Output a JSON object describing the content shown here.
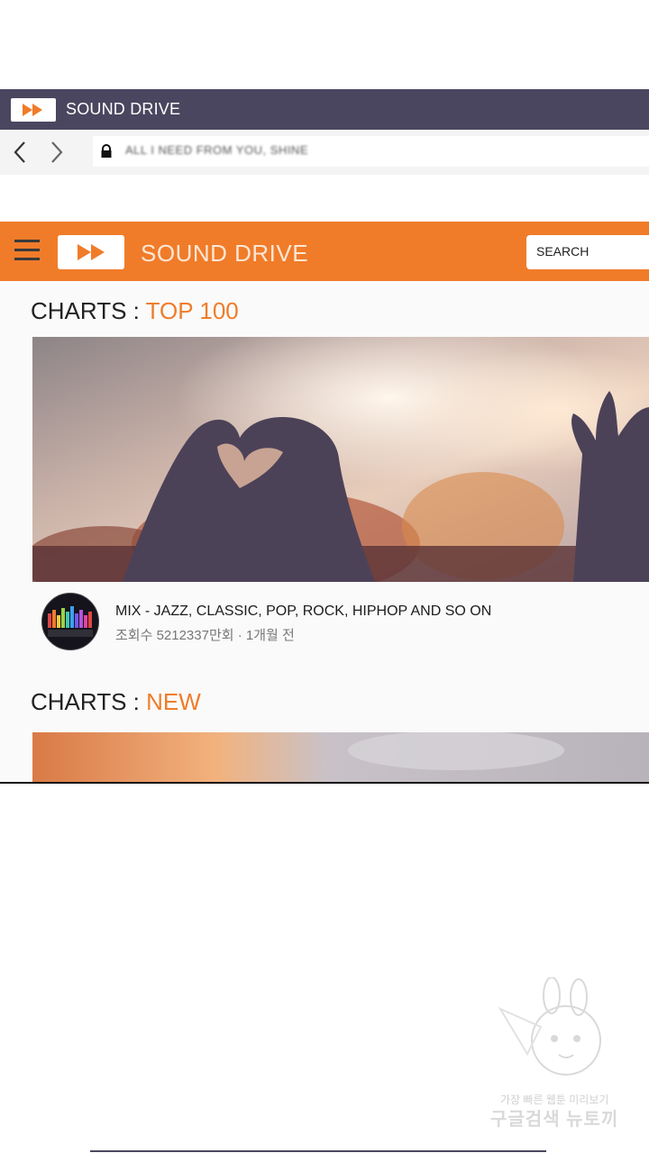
{
  "browser": {
    "tab_title": "SOUND DRIVE",
    "url": "ALL I NEED FROM YOU, SHINE"
  },
  "header": {
    "site_title": "SOUND DRIVE",
    "search_placeholder": "SEARCH"
  },
  "sections": [
    {
      "label": "CHARTS : ",
      "accent": "TOP 100",
      "track": {
        "title": "MIX - JAZZ, CLASSIC, POP, ROCK, HIPHOP AND SO ON",
        "meta": "조회수 5212337만회 · 1개월 전"
      }
    },
    {
      "label": "CHARTS : ",
      "accent": "NEW"
    }
  ],
  "watermark": {
    "line1": "가장 빠른 웹툰 미리보기",
    "line2": "구글검색 뉴토끼"
  },
  "colors": {
    "brand_orange": "#f07c2a",
    "chrome_dark": "#4b465f"
  }
}
